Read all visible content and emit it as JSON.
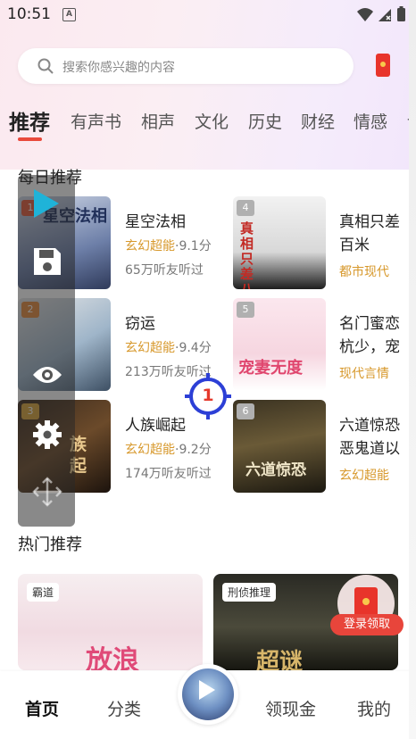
{
  "status_bar": {
    "time": "10:51",
    "notification_letter": "A"
  },
  "search": {
    "placeholder": "搜索你感兴趣的内容"
  },
  "tabs": [
    {
      "label": "推荐",
      "active": true
    },
    {
      "label": "有声书"
    },
    {
      "label": "相声"
    },
    {
      "label": "文化"
    },
    {
      "label": "历史"
    },
    {
      "label": "财经"
    },
    {
      "label": "情感"
    },
    {
      "label": "讠"
    }
  ],
  "daily": {
    "title": "每日推荐",
    "books": [
      {
        "rank": "1",
        "title": "星空法相",
        "genre": "玄幻超能",
        "score": "9.1分",
        "listeners": "65万听友听过",
        "cover_text": "星空法相"
      },
      {
        "rank": "2",
        "title": "窃运",
        "genre": "玄幻超能",
        "score": "9.4分",
        "listeners": "213万听友听过",
        "cover_text": ""
      },
      {
        "rank": "3",
        "title": "人族崛起",
        "genre": "玄幻超能",
        "score": "9.2分",
        "listeners": "174万听友听过",
        "cover_text": "族起"
      },
      {
        "rank": "4",
        "title_line1": "真相只差",
        "title_line2": "百米",
        "tag": "都市现代",
        "cover_text": "真相只差八百米"
      },
      {
        "rank": "5",
        "title_line1": "名门蜜恋",
        "title_line2": "杭少，宠",
        "tag": "现代言情",
        "cover_text": "宠妻无度"
      },
      {
        "rank": "6",
        "title_line1": "六道惊恐",
        "title_line2": "恶鬼道以",
        "tag": "玄幻超能",
        "cover_text": "六道惊恐"
      }
    ]
  },
  "hot": {
    "title": "热门推荐",
    "cards": [
      {
        "tag": "霸道",
        "cover_text": "放浪"
      },
      {
        "tag": "刑侦推理",
        "cover_text": "超谜"
      }
    ],
    "reward_button": "登录领取"
  },
  "overlay": {
    "target_number": "1"
  },
  "bottom_nav": [
    {
      "label": "首页",
      "active": true
    },
    {
      "label": "分类"
    },
    {
      "label": "领现金"
    },
    {
      "label": "我的"
    }
  ],
  "colors": {
    "accent": "#e94a3c",
    "genre": "#d7982b",
    "overlay_target": "#2c3fd6"
  }
}
